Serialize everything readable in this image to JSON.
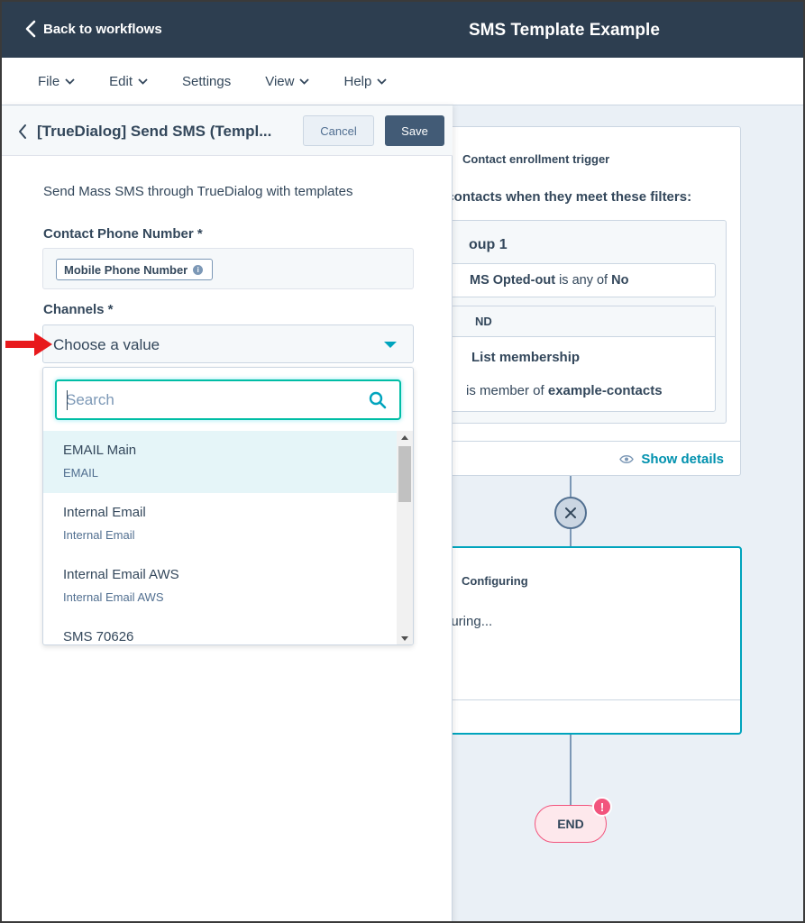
{
  "topbar": {
    "back_label": "Back to workflows",
    "title": "SMS Template Example"
  },
  "menu": {
    "items": [
      {
        "label": "File",
        "has_caret": true
      },
      {
        "label": "Edit",
        "has_caret": true
      },
      {
        "label": "Settings",
        "has_caret": false
      },
      {
        "label": "View",
        "has_caret": true
      },
      {
        "label": "Help",
        "has_caret": true
      }
    ]
  },
  "panel": {
    "title": "[TrueDialog] Send SMS (Templ...",
    "cancel_label": "Cancel",
    "save_label": "Save",
    "description": "Send Mass SMS through TrueDialog with templates",
    "phone_label": "Contact Phone Number *",
    "phone_token": "Mobile Phone Number",
    "channels_label": "Channels *",
    "channels_value": "Choose a value",
    "search_placeholder": "Search",
    "options": [
      {
        "label": "EMAIL Main",
        "sub": "EMAIL",
        "highlighted": true
      },
      {
        "label": "Internal Email",
        "sub": "Internal Email",
        "highlighted": false
      },
      {
        "label": "Internal Email AWS",
        "sub": "Internal Email AWS",
        "highlighted": false
      },
      {
        "label": "SMS 70626",
        "sub": "",
        "highlighted": false
      }
    ]
  },
  "canvas": {
    "trigger_title": "Contact enrollment trigger",
    "trigger_sub": "l contacts when they meet these filters:",
    "group_title": "oup 1",
    "filter1_prop": "MS Opted-out",
    "filter1_op": " is any of ",
    "filter1_val": "No",
    "and_label": "ND",
    "list_membership": "List membership",
    "member_op": " is member of ",
    "member_val": "example-contacts",
    "show_details": "Show details",
    "config_title": "Configuring",
    "config_text": "guring...",
    "end_label": "END",
    "end_badge": "!"
  },
  "colors": {
    "topbar": "#2d3e50",
    "accent": "#00a4bd",
    "save_button": "#425b76",
    "end_node": "#f2547d",
    "arrow": "#e8191c"
  }
}
